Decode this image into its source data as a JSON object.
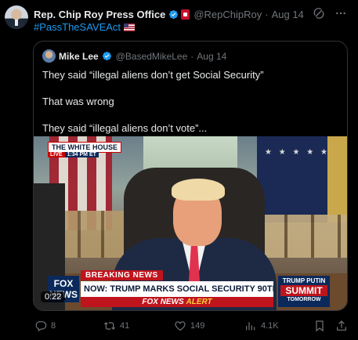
{
  "post": {
    "author_name": "Rep. Chip Roy Press Office",
    "handle": "@RepChipRoy",
    "separator": "·",
    "time": "Aug 14",
    "hashtag": "#PassTheSAVEAct",
    "verified_color": "#1d9bf0",
    "icons": [
      "grok-icon",
      "more-icon"
    ]
  },
  "quote": {
    "author_name": "Mike Lee",
    "handle": "@BasedMikeLee",
    "separator": "·",
    "time": "Aug 14",
    "lines": [
      "They said “illegal aliens don’t get Social Security”",
      "That was wrong",
      "They said “illegal aliens don’t vote”..."
    ],
    "video": {
      "location_tag": "THE WHITE HOUSE",
      "live_label": "LIVE",
      "live_time": "1:34 PM ET",
      "stars": "★ ★ ★ ★ ★",
      "network_logo": "FOX NEWS",
      "breaking": "BREAKING NEWS",
      "headline": "NOW: TRUMP MARKS SOCIAL SECURITY 90TH ANNIVERSARY",
      "alert_prefix": "FOX NEWS",
      "alert_word": "ALERT",
      "promo_top": "TRUMP PUTIN",
      "promo_mid": "SUMMIT",
      "promo_bottom": "TOMORROW",
      "duration": "0:22"
    }
  },
  "actions": {
    "replies": "8",
    "reposts": "41",
    "likes": "149",
    "views": "4.1K"
  }
}
